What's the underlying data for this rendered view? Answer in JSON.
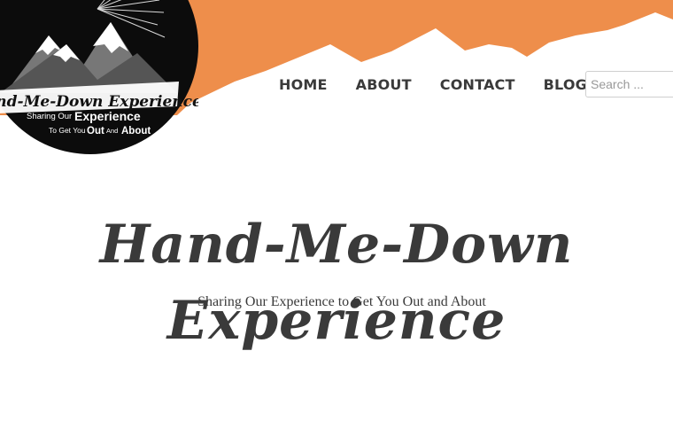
{
  "header": {
    "banner_color": "#ee8e4b",
    "logo": {
      "title": "Hand-Me-Down Experience",
      "line1_small": "Sharing Our",
      "line1_big": "Experience",
      "line2_small": "To Get You",
      "line2_big": "Out",
      "line2_small2": "And",
      "line2_big2": "About"
    }
  },
  "nav": {
    "items": [
      {
        "label": "HOME"
      },
      {
        "label": "ABOUT"
      },
      {
        "label": "CONTACT"
      },
      {
        "label": "BLOG"
      }
    ]
  },
  "search": {
    "placeholder": "Search ..."
  },
  "hero": {
    "title": "Hand-Me-Down Experience",
    "tagline": "Sharing Our Experience to Get You Out and About"
  }
}
